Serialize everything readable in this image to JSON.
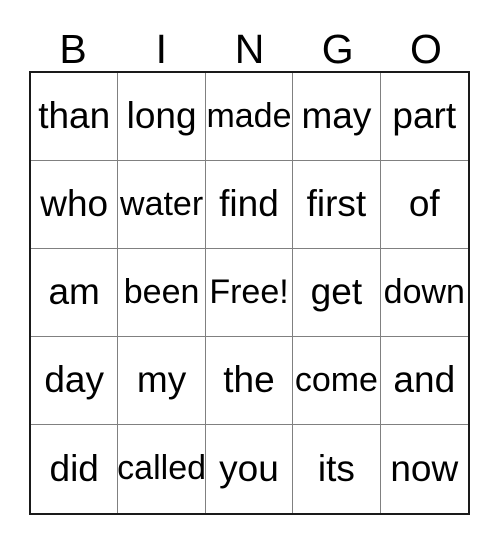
{
  "card": {
    "title": "BINGO",
    "header_letters": [
      "B",
      "I",
      "N",
      "G",
      "O"
    ],
    "free_space_label": "Free!",
    "colors": {
      "background": "#ffffff",
      "text": "#000000",
      "outer_border": "#1a1a1a",
      "inner_grid_line": "#808080"
    },
    "grid": {
      "columns": 5,
      "rows": 5,
      "cells": [
        [
          "than",
          "long",
          "made",
          "may",
          "part"
        ],
        [
          "who",
          "water",
          "find",
          "first",
          "of"
        ],
        [
          "am",
          "been",
          "Free!",
          "get",
          "down"
        ],
        [
          "day",
          "my",
          "the",
          "come",
          "and"
        ],
        [
          "did",
          "called",
          "you",
          "its",
          "now"
        ]
      ]
    }
  }
}
